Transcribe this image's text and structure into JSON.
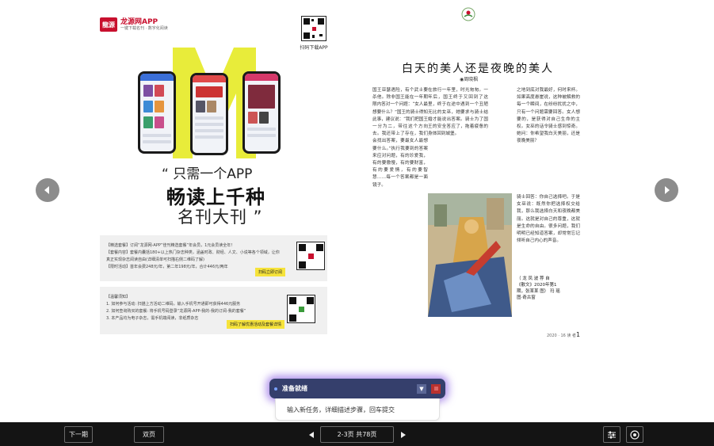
{
  "left_page": {
    "brand_name": "龙源网APP",
    "brand_tagline": "一键下载名刊 · 数字化阅读",
    "brand_logo_text": "龍源",
    "qr_caption": "扫码下载APP",
    "slogan_line1": "“ 只需一个APP",
    "slogan_line2": "畅读上千种",
    "slogan_line3": "名刊大刊 ”",
    "promo1": {
      "lines": [
        "【精选套餐】订阅“龙源网-APP”佳刊精选套餐”年会员，1元会员读全年！",
        "【套餐内容】套餐内囊括180+以上热门杂志种类，涵盖时政、财经、人文、小说等各个领域，让你",
        "真正实现杂志阅读自由(详细清单可扫描右侧二维码了解)",
        "【限时活动】首年会费248元/年，第二年198元/年，合计446元/两年"
      ],
      "cta": "扫码立即订阅"
    },
    "promo2": {
      "lines": [
        "【温馨须知】",
        "1. 如何参与活动: 扫描上方活动二维码，输入手机号开通即可获得446元服务",
        "2. 如何查询购买的套餐: 将手机号码登录“龙源网-APP-我的-我的订阅-我的套餐”",
        "3. 本产品均为电子杂志，需手机端阅读，非纸质杂志"
      ],
      "cta": "扫码了解优惠活动及套餐详情"
    }
  },
  "right_page": {
    "title": "白天的美人还是夜晚的美人",
    "author": "◉周晓枫",
    "columns": [
      "国王亚瑟遇险，有个武士要杀他。除非国王能在一年期限内答对一个问题：“女人最想要什么？”国王的骑士得知此事，建议说：“我们把国王一分为二，带往这个方向去。我还带上了存在，我们会找出答案，要最女人最想要什么。”",
      "",
      "",
      ""
    ],
    "col1": "国王亚瑟遇险，有个武士要杀他。除非国王能在一年期限内答对一个问题：“女人最想要什么？”国王的骑士得知此事，建议说：“我们把国王一分为二，带往这个方向去。我还带上了存在，我们会找出答案，要最女人最想要什么。”执行我要到的答案来应对问题，有的珍爱我，有的要傲慢，有的要财富，有的要爱情，有的要智慧……每一个答案都是一面镜子。",
    "col2": "在旅行一年里，时光匆匆。一年后，国王终于又回到了这里，终于在途中遇到一个丑陋无比的女巫，她要求与骑士结婚才能说出答案。骑士为了国王的安全答应了，拖着疲惫的身体回到城堡。",
    "col3": "之地到底对我最好，何时来杯。如果高度悬崖说，这种被解救的每一个瞬间，在纷纷扰扰之中，只有一个问题需要回答。女人想要的，是获得对自己生命的主权。女巫的话令骑士感到惊奇。她问：你希望我白天美丽，还是夜晚美丽？",
    "col4": "骑士回答：你自己选择吧。于是女巫说：既然你把选择权交给我，那么我选择白天和夜晚都美丽。这就是对自己的尊重，这就是生命的自由。很多问题，我们明明已经知道答案，却常常忘记倾听自己内心的声音。",
    "credit_line1": "（  龙 凤 波 荐 自",
    "credit_line2": "《散文》2020年第1",
    "credit_line3": "期，张某某 图） 玛 瑶",
    "credit_line4": "图·奇古窗",
    "footer_mark": "2020 · 16  读 者",
    "page_number": "1"
  },
  "assistant": {
    "status": "准备就绪",
    "input_placeholder": "输入新任务，详细描述步骤，回车提交"
  },
  "toolbar": {
    "next_issue": "下一期",
    "double_page": "双页",
    "page_indicator": "2-3页 共78页"
  },
  "icons": {
    "prev": "chevron-left-icon",
    "next": "chevron-right-icon",
    "settings": "sliders-icon",
    "target": "target-icon"
  },
  "colors": {
    "brand_red": "#c8102e",
    "accent_yellow": "#f6e33b",
    "toolbar_bg": "#141414",
    "assistant_bg": "#353f6c",
    "assistant_glow": "#966ee6"
  }
}
